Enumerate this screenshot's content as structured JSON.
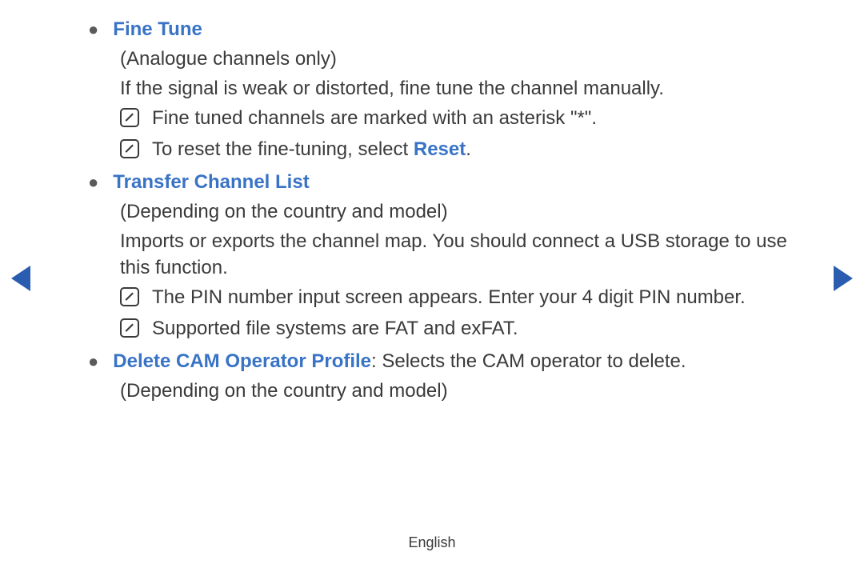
{
  "sections": [
    {
      "title": "Fine Tune",
      "title_style": "blue",
      "subtitle": "(Analogue channels only)",
      "body": "If the signal is weak or distorted, fine tune the channel manually.",
      "notes": [
        {
          "text": "Fine tuned channels are marked with an asterisk \"*\"."
        },
        {
          "prefix": "To reset the fine-tuning, select ",
          "highlight": "Reset",
          "suffix": "."
        }
      ]
    },
    {
      "title": "Transfer Channel List",
      "title_style": "blue",
      "subtitle": "(Depending on the country and model)",
      "body": "Imports or exports the channel map. You should connect a USB storage to use this function.",
      "notes": [
        {
          "text": "The PIN number input screen appears. Enter your 4 digit PIN number."
        },
        {
          "text": "Supported file systems are FAT and exFAT."
        }
      ]
    },
    {
      "title": "Delete CAM Operator Profile",
      "title_style": "blue",
      "inline_after_title": ": Selects the CAM operator to delete.",
      "subtitle": "(Depending on the country and model)"
    }
  ],
  "footer": "English"
}
